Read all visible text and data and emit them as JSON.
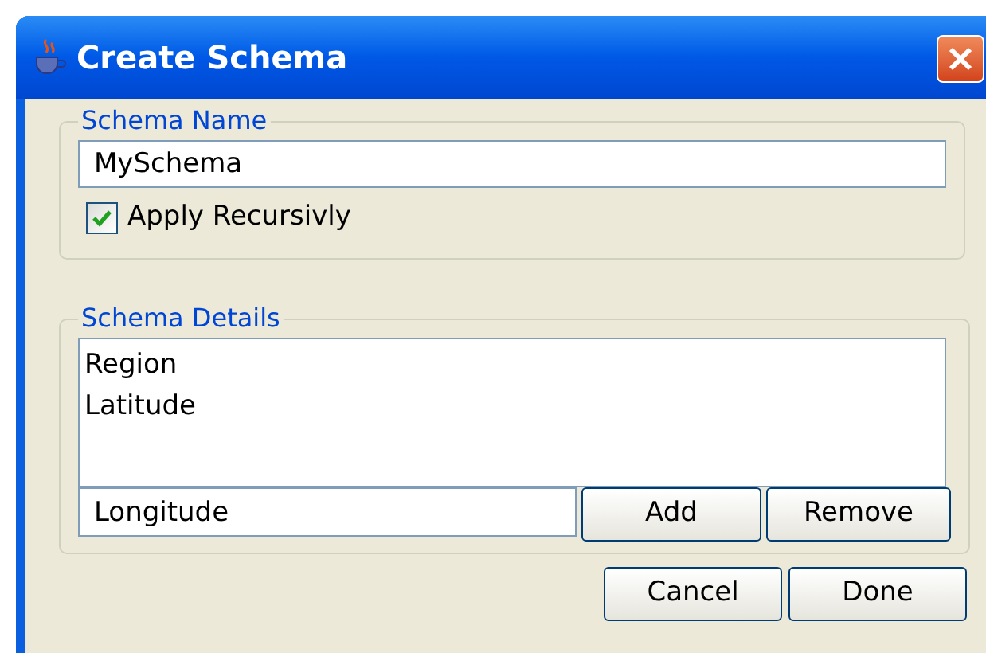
{
  "window": {
    "title": "Create Schema"
  },
  "schema_name": {
    "legend": "Schema Name",
    "value": "MySchema",
    "apply_recursively": {
      "label": "Apply Recursivly",
      "checked": true
    }
  },
  "schema_details": {
    "legend": "Schema Details",
    "items": [
      "Region",
      "Latitude"
    ],
    "new_item": {
      "value": "Longitude"
    },
    "buttons": [
      "Add",
      "Remove"
    ]
  },
  "buttons": [
    "Cancel",
    "Done"
  ]
}
